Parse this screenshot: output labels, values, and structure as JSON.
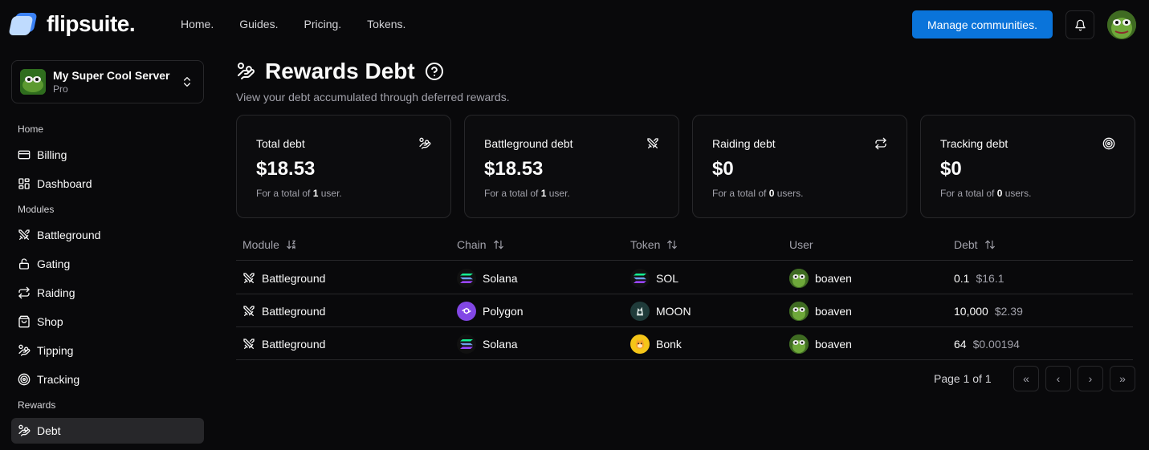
{
  "app": {
    "name": "flipsuite."
  },
  "nav": {
    "links": [
      "Home.",
      "Guides.",
      "Pricing.",
      "Tokens."
    ],
    "cta": "Manage communities."
  },
  "server": {
    "name": "My Super Cool Server",
    "plan": "Pro"
  },
  "sidebar": {
    "sections": [
      "Home",
      "Modules",
      "Rewards"
    ],
    "items": [
      {
        "label": "Billing",
        "icon": "credit-card-icon"
      },
      {
        "label": "Dashboard",
        "icon": "dashboard-icon"
      },
      {
        "label": "Battleground",
        "icon": "swords-icon"
      },
      {
        "label": "Gating",
        "icon": "lock-icon"
      },
      {
        "label": "Raiding",
        "icon": "repeat-icon"
      },
      {
        "label": "Shop",
        "icon": "shopping-bag-icon"
      },
      {
        "label": "Tipping",
        "icon": "hand-coins-icon"
      },
      {
        "label": "Tracking",
        "icon": "target-icon"
      },
      {
        "label": "Debt",
        "icon": "hand-coins-icon",
        "active": true
      }
    ]
  },
  "page": {
    "title": "Rewards Debt",
    "subtitle": "View your debt accumulated through deferred rewards."
  },
  "cards": [
    {
      "title": "Total debt",
      "value": "$18.53",
      "note_pre": "For a total of",
      "count": "1",
      "note_post": "user.",
      "icon": "hand-coins-icon"
    },
    {
      "title": "Battleground debt",
      "value": "$18.53",
      "note_pre": "For a total of",
      "count": "1",
      "note_post": "user.",
      "icon": "swords-icon"
    },
    {
      "title": "Raiding debt",
      "value": "$0",
      "note_pre": "For a total of",
      "count": "0",
      "note_post": "users.",
      "icon": "repeat-icon"
    },
    {
      "title": "Tracking debt",
      "value": "$0",
      "note_pre": "For a total of",
      "count": "0",
      "note_post": "users.",
      "icon": "target-icon"
    }
  ],
  "table": {
    "headers": [
      "Module",
      "Chain",
      "Token",
      "User",
      "Debt"
    ],
    "rows": [
      {
        "module": "Battleground",
        "chain": "Solana",
        "token": "SOL",
        "user": "boaven",
        "amount": "0.1",
        "usd": "$16.1"
      },
      {
        "module": "Battleground",
        "chain": "Polygon",
        "token": "MOON",
        "user": "boaven",
        "amount": "10,000",
        "usd": "$2.39"
      },
      {
        "module": "Battleground",
        "chain": "Solana",
        "token": "Bonk",
        "user": "boaven",
        "amount": "64",
        "usd": "$0.00194"
      }
    ]
  },
  "pagination": {
    "text": "Page 1 of 1",
    "first": "«",
    "prev": "‹",
    "next": "›",
    "last": "»"
  },
  "colors": {
    "accent": "#0a74da",
    "background": "#09090b",
    "border": "#27272a",
    "polygon": "#8247e5",
    "bonk": "#f5c518"
  }
}
